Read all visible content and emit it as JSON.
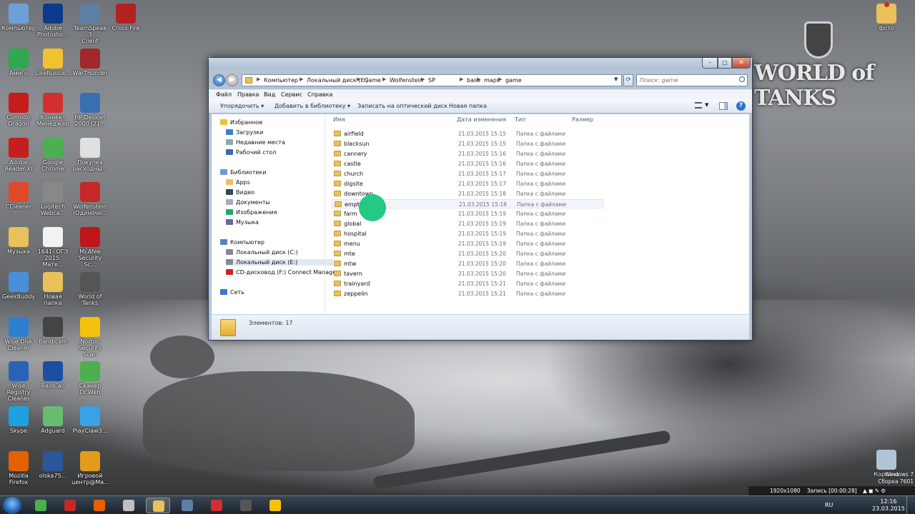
{
  "desktop_icons": [
    {
      "label": "Компьютер",
      "name": "computer-icon",
      "color": "#6f9fd8"
    },
    {
      "label": "Adobe\nPhotosho...",
      "name": "photoshop-icon",
      "color": "#0b3b8a"
    },
    {
      "label": "TeamSpeak 3\nClient",
      "name": "teamspeak-icon",
      "color": "#5c7fa3"
    },
    {
      "label": "Cross Fire",
      "name": "crossfire-icon",
      "color": "#b22222"
    },
    {
      "label": "Амиго",
      "name": "amigo-icon",
      "color": "#2fa84f"
    },
    {
      "label": "LikeRussia...",
      "name": "likerussia-icon",
      "color": "#f2c12e"
    },
    {
      "label": "WarThunder",
      "name": "warthunder-icon",
      "color": "#a02828"
    },
    {
      "label": "Comodo\nDragon",
      "name": "comodo-dragon-icon",
      "color": "#c61c1c"
    },
    {
      "label": "Коннект\nМенеджер",
      "name": "connect-manager-icon",
      "color": "#d32f2f"
    },
    {
      "label": "HP Deskjet\n2000 J21...",
      "name": "hp-deskjet-icon",
      "color": "#3a6fb0"
    },
    {
      "label": "Adobe\nReader XI",
      "name": "adobe-reader-icon",
      "color": "#c41e1e"
    },
    {
      "label": "Google\nChrome",
      "name": "chrome-icon",
      "color": "#4caf50"
    },
    {
      "label": "Покупка\nрасходны...",
      "name": "purchase-supplies-icon",
      "color": "#e0e0e0"
    },
    {
      "label": "CCleaner",
      "name": "ccleaner-icon",
      "color": "#e04a2a"
    },
    {
      "label": "Logitech\nWebca...",
      "name": "logitech-webcam-icon",
      "color": "#888"
    },
    {
      "label": "Wolfenstein\n(Одиночн...",
      "name": "wolfenstein-icon",
      "color": "#c62828"
    },
    {
      "label": "Музыка",
      "name": "music-folder-icon",
      "color": "#e8c15a"
    },
    {
      "label": "1641- ОГЭ\n2015. Мате...",
      "name": "pdf-doc-icon",
      "color": "#f2f2f2"
    },
    {
      "label": "McAfee\nSecurity Sc...",
      "name": "mcafee-icon",
      "color": "#c0151b"
    },
    {
      "label": "GeekBuddy",
      "name": "geekbuddy-icon",
      "color": "#4a90d9"
    },
    {
      "label": "Новая папка",
      "name": "new-folder-icon",
      "color": "#e8c15a"
    },
    {
      "label": "World of\nTanks",
      "name": "world-of-tanks-icon",
      "color": "#555"
    },
    {
      "label": "Wise Disk\nCleaner",
      "name": "wise-disk-cleaner-icon",
      "color": "#2f7fd0"
    },
    {
      "label": "Bandicam",
      "name": "bandicam-icon",
      "color": "#444"
    },
    {
      "label": "Norton\nSecurity Scan",
      "name": "norton-icon",
      "color": "#f4c20d"
    },
    {
      "label": "Wise Registry\nCleaner",
      "name": "wise-registry-icon",
      "color": "#2a62b5"
    },
    {
      "label": "RaidCall",
      "name": "raidcall-icon",
      "color": "#1c4fa0"
    },
    {
      "label": "Сканер\nDr.Web",
      "name": "drweb-icon",
      "color": "#4caf50"
    },
    {
      "label": "Skype",
      "name": "skype-icon",
      "color": "#1da1e2"
    },
    {
      "label": "Adguard",
      "name": "adguard-icon",
      "color": "#68bc71"
    },
    {
      "label": "PlayClaw3...",
      "name": "playclaw-icon",
      "color": "#3aa0e8"
    },
    {
      "label": "Mozilla\nFirefox",
      "name": "firefox-icon",
      "color": "#e66000"
    },
    {
      "label": "olska75...",
      "name": "word-doc-icon",
      "color": "#2b579a"
    },
    {
      "label": "Игровой\nцентр@Ма...",
      "name": "game-center-icon",
      "color": "#e39b1b"
    },
    {
      "label": "фото",
      "name": "photo-folder-icon",
      "color": "#e8c15a"
    },
    {
      "label": "Корзина",
      "name": "recycle-bin-icon",
      "color": "#b0c4d8"
    }
  ],
  "wot_logo": "WORLD of TANKS",
  "explorer": {
    "breadcrumbs": [
      "Компьютер",
      "Локальный диск (E:)",
      "Game",
      "Wolfenstein",
      "SP",
      "base",
      "maps",
      "game"
    ],
    "search_placeholder": "Поиск: game",
    "menu": [
      "Файл",
      "Правка",
      "Вид",
      "Сервис",
      "Справка"
    ],
    "toolbar": [
      "Упорядочить ▾",
      "Добавить в библиотеку ▾",
      "Записать на оптический диск",
      "Новая папка"
    ],
    "nav": {
      "favorites": "Избранное",
      "favorites_items": [
        "Загрузки",
        "Недавние места",
        "Рабочий стол"
      ],
      "libraries": "Библиотеки",
      "libraries_items": [
        "Apps",
        "Видео",
        "Документы",
        "Изображения",
        "Музыка"
      ],
      "computer": "Компьютер",
      "computer_items": [
        "Локальный диск (C:)",
        "Локальный диск (E:)",
        "CD-дисковод (F:) Connect Manage"
      ],
      "network": "Сеть"
    },
    "columns": [
      "Имя",
      "Дата изменения",
      "Тип",
      "Размер"
    ],
    "files": [
      {
        "name": "airfield",
        "date": "21.03.2015 15:15",
        "type": "Папка с файлами"
      },
      {
        "name": "blacksun",
        "date": "21.03.2015 15:15",
        "type": "Папка с файлами"
      },
      {
        "name": "cannery",
        "date": "21.03.2015 15:16",
        "type": "Папка с файлами"
      },
      {
        "name": "castle",
        "date": "21.03.2015 15:16",
        "type": "Папка с файлами"
      },
      {
        "name": "church",
        "date": "21.03.2015 15:17",
        "type": "Папка с файлами"
      },
      {
        "name": "digsite",
        "date": "21.03.2015 15:17",
        "type": "Папка с файлами"
      },
      {
        "name": "downtown",
        "date": "21.03.2015 15:18",
        "type": "Папка с файлами"
      },
      {
        "name": "empty",
        "date": "21.03.2015 15:18",
        "type": "Папка с файлами"
      },
      {
        "name": "farm",
        "date": "21.03.2015 15:19",
        "type": "Папка с файлами"
      },
      {
        "name": "global",
        "date": "21.03.2015 15:19",
        "type": "Папка с файлами"
      },
      {
        "name": "hospital",
        "date": "21.03.2015 15:19",
        "type": "Папка с файлами"
      },
      {
        "name": "menu",
        "date": "21.03.2015 15:19",
        "type": "Папка с файлами"
      },
      {
        "name": "mte",
        "date": "21.03.2015 15:20",
        "type": "Папка с файлами"
      },
      {
        "name": "mtw",
        "date": "21.03.2015 15:20",
        "type": "Папка с файлами"
      },
      {
        "name": "tavern",
        "date": "21.03.2015 15:20",
        "type": "Папка с файлами"
      },
      {
        "name": "trainyard",
        "date": "21.03.2015 15:21",
        "type": "Папка с файлами"
      },
      {
        "name": "zeppelin",
        "date": "21.03.2015 15:21",
        "type": "Папка с файлами"
      }
    ],
    "status": "Элементов: 17"
  },
  "taskbar": {
    "apps": [
      "chrome-icon",
      "opera-icon",
      "firefox-icon",
      "wolfenstein-icon",
      "explorer-icon",
      "teamspeak-icon",
      "connect-manager-icon",
      "world-of-tanks-icon",
      "warning-icon"
    ],
    "lang": "RU",
    "time": "12:16",
    "date": "23.03.2015"
  },
  "recording": {
    "resolution": "1920x1080",
    "status": "Запись [00:00:28]"
  },
  "watermark": {
    "line1": "Windows 7",
    "line2": "Сборка 7601"
  }
}
